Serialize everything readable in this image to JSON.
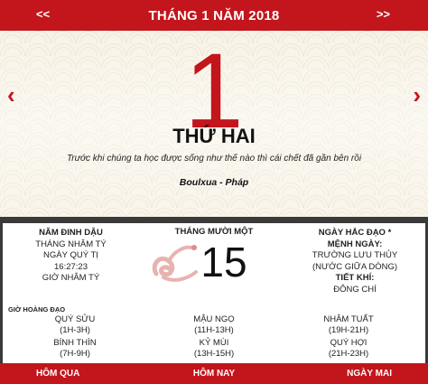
{
  "header": {
    "title": "THÁNG 1 NĂM 2018",
    "prev_label": "<<",
    "next_label": ">>"
  },
  "solar": {
    "day": "1",
    "weekday": "THỨ HAI",
    "quote": "Trước khi chúng ta học được sống như thế nào thì cái chết đã gần bên rồi",
    "author": "Boulxua - Pháp",
    "prev_arrow": "‹",
    "next_arrow": "›"
  },
  "lunar": {
    "left": {
      "year": "NĂM ĐINH DẬU",
      "month": "THÁNG NHÂM TÝ",
      "day": "NGÀY QUÝ TỊ",
      "time": "16:27:23",
      "hour": "GIỜ NHÂM TÝ"
    },
    "month_label": "THÁNG MƯỜI MỘT",
    "day": "15",
    "right": {
      "day_type": "NGÀY HẮC ĐẠO *",
      "menh_label": "MỆNH NGÀY:",
      "menh_value1": "TRƯỜNG LƯU THỦY",
      "menh_value2": "(NƯỚC GIỮA DÒNG)",
      "tietkhi_label": "TIẾT KHÍ:",
      "tietkhi_value": "ĐÔNG CHÍ"
    },
    "hours_label": "GIỜ HOÀNG ĐẠO",
    "hours": [
      {
        "name": "QUÝ SỬU",
        "range": "(1H-3H)"
      },
      {
        "name": "MẬU NGỌ",
        "range": "(11H-13H)"
      },
      {
        "name": "NHÂM TUẤT",
        "range": "(19H-21H)"
      },
      {
        "name": "BÍNH THÌN",
        "range": "(7H-9H)"
      },
      {
        "name": "KỶ MÙI",
        "range": "(13H-15H)"
      },
      {
        "name": "QUÝ HỢI",
        "range": "(21H-23H)"
      }
    ]
  },
  "footer": {
    "prev_label": "HÔM QUA",
    "today_label": "HÔM NAY",
    "next_label": "NGÀY MAI"
  },
  "colors": {
    "accent": "#c3151c",
    "pattern": "#ece1cb"
  },
  "icons": {
    "zodiac": "snake-icon"
  }
}
